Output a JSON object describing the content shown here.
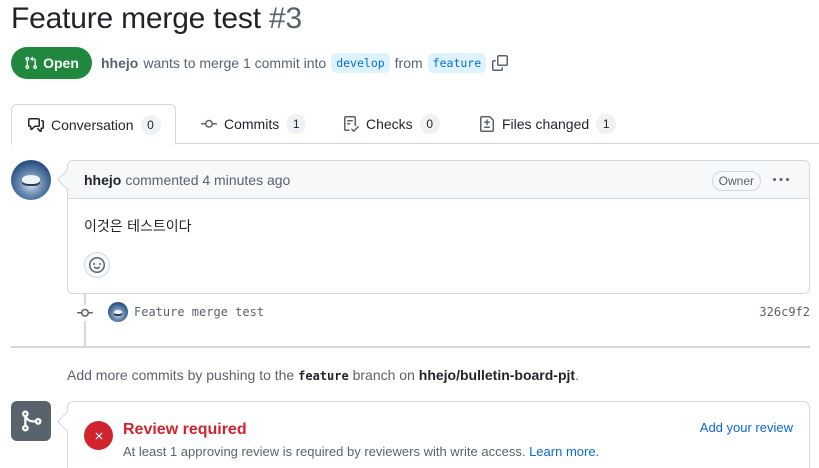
{
  "pr": {
    "title": "Feature merge test",
    "number": "#3",
    "state": "Open",
    "author": "hhejo",
    "merge_text": "wants to merge 1 commit into",
    "base_branch": "develop",
    "from_text": "from",
    "head_branch": "feature"
  },
  "tabs": [
    {
      "label": "Conversation",
      "count": "0",
      "icon": "comment-discussion-icon"
    },
    {
      "label": "Commits",
      "count": "1",
      "icon": "git-commit-icon"
    },
    {
      "label": "Checks",
      "count": "0",
      "icon": "checklist-icon"
    },
    {
      "label": "Files changed",
      "count": "1",
      "icon": "file-diff-icon"
    }
  ],
  "comment": {
    "author": "hhejo",
    "meta": "commented 4 minutes ago",
    "role_label": "Owner",
    "body": "이것은 테스트이다"
  },
  "commit": {
    "message": "Feature merge test",
    "sha": "326c9f2"
  },
  "push_hint": {
    "prefix": "Add more commits by pushing to the",
    "branch": "feature",
    "middle": "branch on",
    "repo": "hhejo/bulletin-board-pjt",
    "suffix": "."
  },
  "merge_box": {
    "title": "Review required",
    "description": "At least 1 approving review is required by reviewers with write access.",
    "learn_more": "Learn more.",
    "add_review": "Add your review"
  },
  "colors": {
    "open_green": "#1f883d",
    "danger_red": "#d1242f",
    "link_blue": "#0969da",
    "muted": "#59636e",
    "border": "#d1d9e0"
  }
}
